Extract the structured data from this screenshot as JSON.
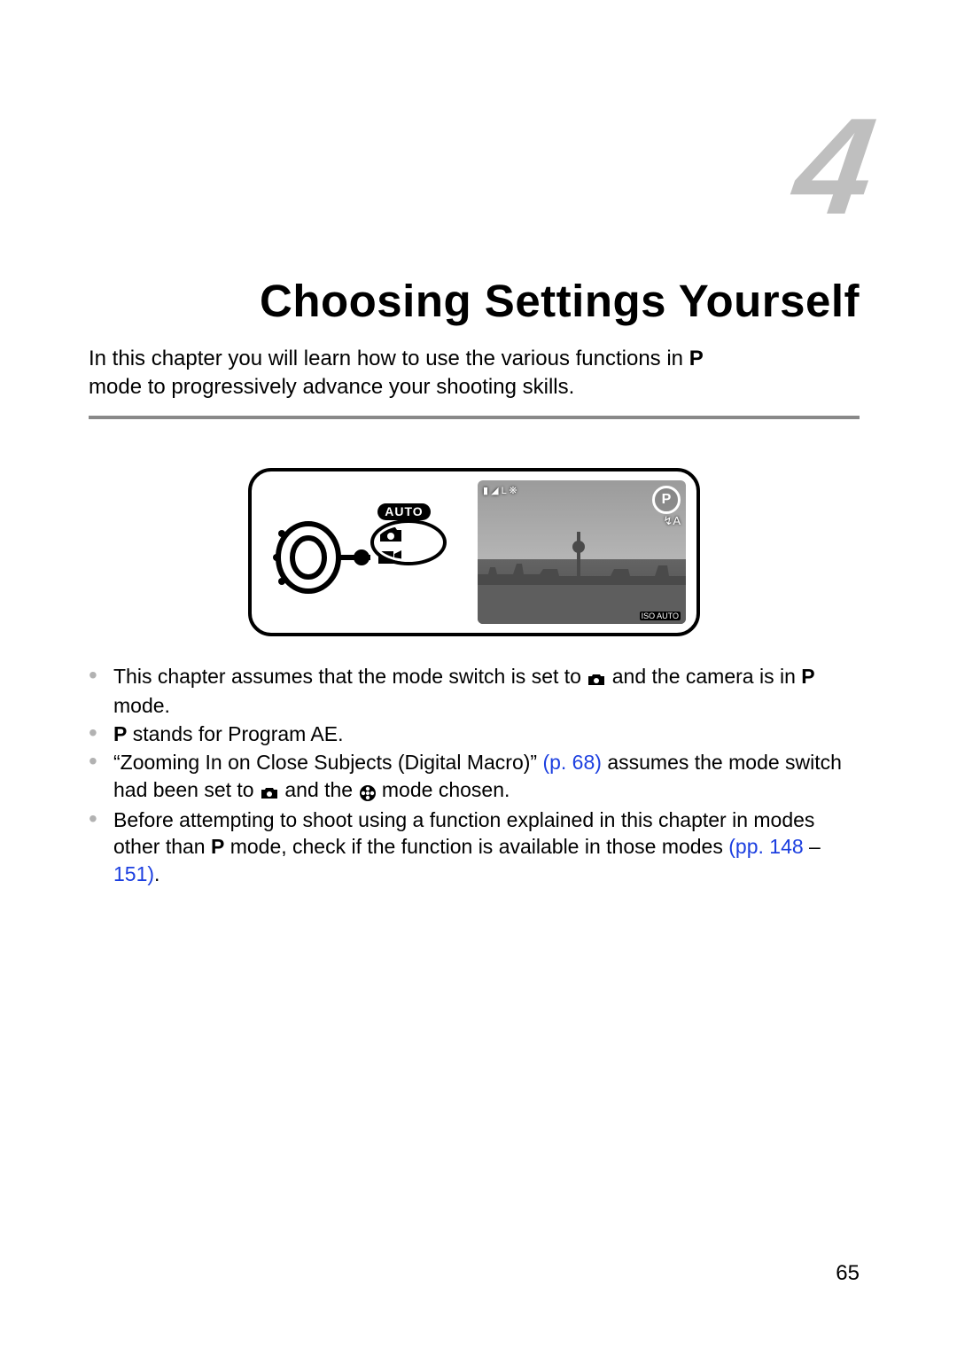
{
  "chapter": {
    "number": "4",
    "title": "Choosing Settings Yourself",
    "intro_line1": "In this chapter you will learn how to use the various functions in ",
    "intro_p_icon_name": "P",
    "intro_line2": "mode to progressively advance your shooting skills."
  },
  "diagram": {
    "auto_label": "AUTO",
    "p_badge": "P",
    "overlay_top_left": "▮ ◢ L ❋",
    "overlay_right_sub": "↯A",
    "overlay_bottom_right": "ISO AUTO"
  },
  "bullets": {
    "b1a": "This chapter assumes that the mode switch is set to ",
    "b1b": " and the camera is in ",
    "b1c": " mode.",
    "b2a": "",
    "b2b": " stands for Program AE.",
    "b3a": "“Zooming In on Close Subjects (Digital Macro)” ",
    "b3link": "(p. 68)",
    "b3b": " assumes the mode switch had been set to ",
    "b3c": " and the ",
    "b3d": " mode chosen.",
    "b4a": "Before attempting to shoot using a function explained in this chapter in modes other than ",
    "b4b": " mode, check if the function is available in those modes ",
    "b4link1": "(pp. 148",
    "b4dash": " – ",
    "b4link2": "151)",
    "b4end": "."
  },
  "page_number": "65",
  "links": {
    "p68": "(p. 68)",
    "pp148": "(pp. 148",
    "pp151": "151)"
  }
}
